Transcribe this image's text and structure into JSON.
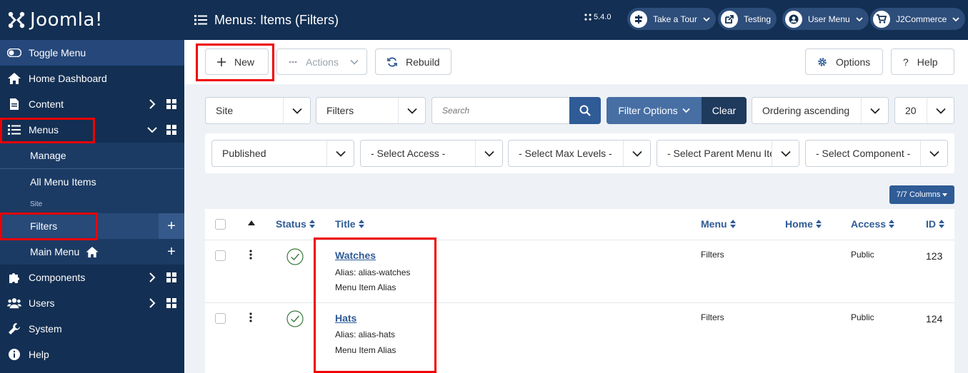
{
  "app": {
    "logo_text": "Joomla!",
    "version": "5.4.0"
  },
  "header": {
    "title": "Menus: Items (Filters)",
    "buttons": [
      {
        "label": "Take a Tour"
      },
      {
        "label": "Testing"
      },
      {
        "label": "User Menu"
      },
      {
        "label": "J2Commerce"
      }
    ]
  },
  "sidebar": {
    "toggle": "Toggle Menu",
    "items": [
      {
        "label": "Home Dashboard"
      },
      {
        "label": "Content"
      },
      {
        "label": "Menus"
      },
      {
        "label": "Components"
      },
      {
        "label": "Users"
      },
      {
        "label": "System"
      },
      {
        "label": "Help"
      }
    ],
    "menus_sub": {
      "manage": "Manage",
      "all_items": "All Menu Items",
      "section_label": "Site",
      "filters": "Filters",
      "main_menu": "Main Menu"
    }
  },
  "toolbar": {
    "new_label": "New",
    "actions_label": "Actions",
    "rebuild_label": "Rebuild",
    "options_label": "Options",
    "help_label": "Help"
  },
  "filters": {
    "site": "Site",
    "menu": "Filters",
    "search_placeholder": "Search",
    "filter_options": "Filter Options",
    "clear": "Clear",
    "ordering": "Ordering ascending",
    "limit": "20",
    "published": "Published",
    "access": "- Select Access -",
    "max_levels": "- Select Max Levels -",
    "parent": "- Select Parent Menu Item -",
    "component": "- Select Component -",
    "columns": "7/7 Columns"
  },
  "table": {
    "headers": {
      "status": "Status",
      "title": "Title",
      "menu": "Menu",
      "home": "Home",
      "access": "Access",
      "id": "ID"
    },
    "rows": [
      {
        "title": "Watches",
        "alias": "Alias: alias-watches",
        "type": "Menu Item Alias",
        "menu": "Filters",
        "access": "Public",
        "id": "123"
      },
      {
        "title": "Hats",
        "alias": "Alias: alias-hats",
        "type": "Menu Item Alias",
        "menu": "Filters",
        "access": "Public",
        "id": "124"
      }
    ]
  },
  "colors": {
    "sidebar_bg": "#132f53",
    "accent": "#2f5b96",
    "highlight": "#e00000"
  }
}
